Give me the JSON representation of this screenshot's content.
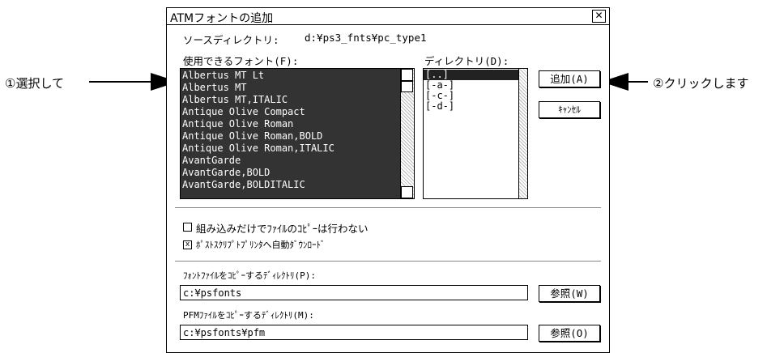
{
  "dialog": {
    "title": "ATMフォントの追加",
    "close_glyph": "✕",
    "source_dir_label": "ソースディレクトリ:",
    "source_dir_value": "d:¥ps3_fnts¥pc_type1",
    "fonts_label": "使用できるフォント(F):",
    "fonts": [
      "Albertus MT Lt",
      "Albertus MT",
      "Albertus MT,ITALIC",
      "Antique Olive Compact",
      "Antique Olive Roman",
      "Antique Olive Roman,BOLD",
      "Antique Olive Roman,ITALIC",
      "AvantGarde",
      "AvantGarde,BOLD",
      "AvantGarde,BOLDITALIC"
    ],
    "dirs_label": "ディレクトリ(D):",
    "dirs": [
      "[..]",
      "[-a-]",
      "[-c-]",
      "[-d-]"
    ],
    "add_button": "追加(A)",
    "cancel_button": "ｷｬﾝｾﾙ",
    "option_install_only": "組み込みだけでﾌｧｲﾙのｺﾋﾟｰは行わない",
    "option_install_only_checked": false,
    "option_auto_download": "ﾎﾟｽﾄｽｸﾘﾌﾟﾄﾌﾟﾘﾝﾀへ自動ﾀﾞｳﾝﾛｰﾄﾞ",
    "option_auto_download_checked": true,
    "fontfile_dir_label": "ﾌｫﾝﾄﾌｧｲﾙをｺﾋﾟｰするﾃﾞｨﾚｸﾄﾘ(P):",
    "fontfile_dir_value": "c:¥psfonts",
    "browse1_button": "参照(W)",
    "pfm_dir_label": "PFMﾌｧｲﾙをｺﾋﾟｰするﾃﾞｨﾚｸﾄﾘ(M):",
    "pfm_dir_value": "c:¥psfonts¥pfm",
    "browse2_button": "参照(O)"
  },
  "annotations": {
    "step1": "①選択して",
    "step2": "②クリックします"
  },
  "checkbox_marks": {
    "checked": "x",
    "unchecked": ""
  },
  "scroll_glyphs": {
    "up": "▲",
    "down": "▼"
  }
}
